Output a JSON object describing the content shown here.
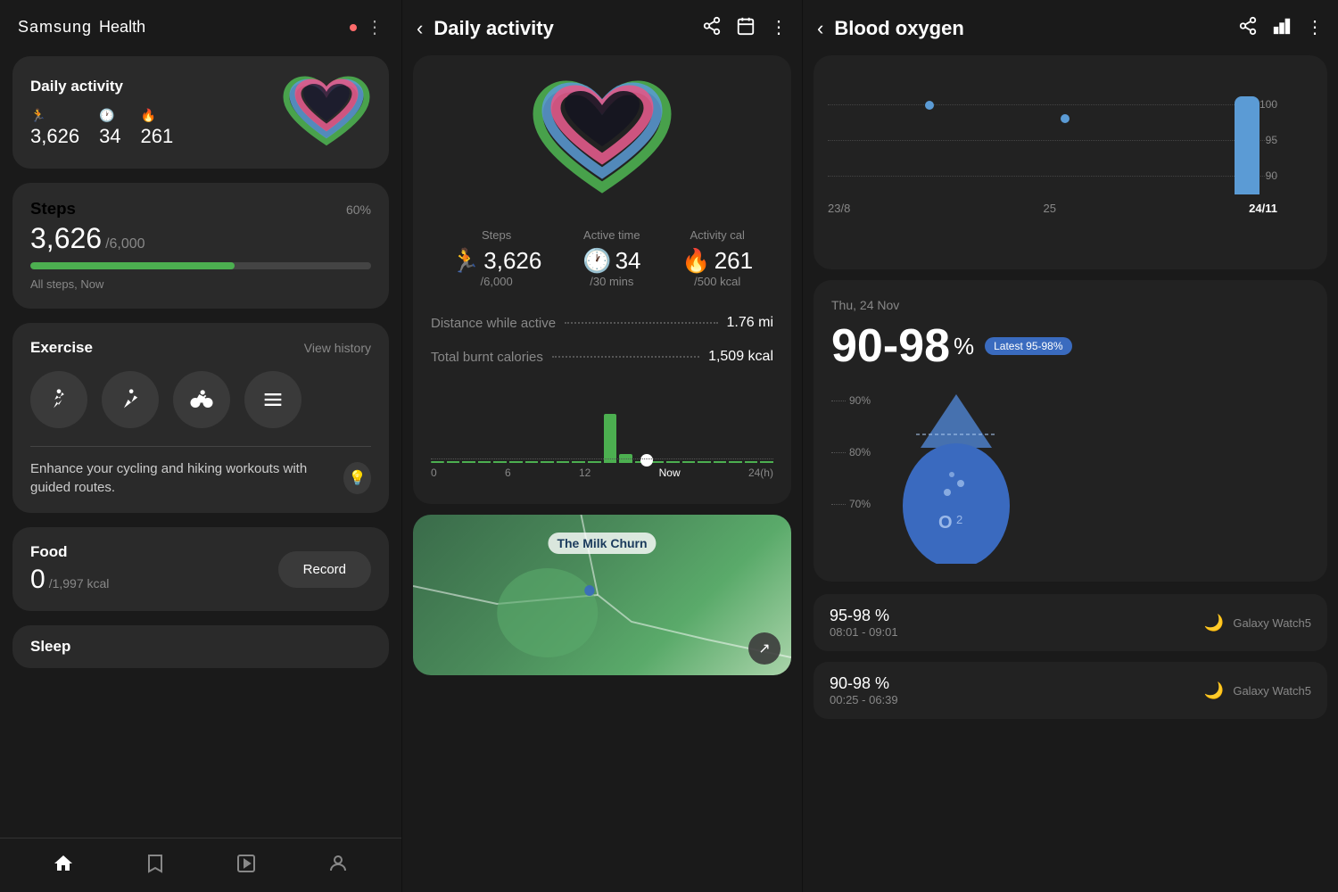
{
  "app": {
    "name": "Samsung",
    "sub": "Health"
  },
  "left": {
    "header": {
      "brand": "Samsung",
      "health": "Health",
      "more_label": "⋮"
    },
    "daily_activity": {
      "title": "Daily activity",
      "steps_icon": "🏃",
      "steps_value": "3,626",
      "active_icon": "🕐",
      "active_value": "34",
      "cal_icon": "🔥",
      "cal_value": "261"
    },
    "steps": {
      "title": "Steps",
      "value": "3,626",
      "goal": "/6,000",
      "percent": "60%",
      "progress": 60,
      "sub": "All steps, Now"
    },
    "exercise": {
      "title": "Exercise",
      "view_history": "View history",
      "tip": "Enhance your cycling and hiking workouts with guided routes."
    },
    "food": {
      "title": "Food",
      "value": "0",
      "goal": "/1,997 kcal",
      "record_btn": "Record"
    },
    "sleep": {
      "title": "Sleep"
    },
    "nav": {
      "home": "🏠",
      "bookmark": "🔖",
      "play": "▶",
      "person": "👤"
    }
  },
  "center": {
    "header": {
      "back": "‹",
      "title": "Daily activity",
      "share": "share-icon",
      "calendar": "calendar-icon",
      "more": "more-icon"
    },
    "stats": {
      "steps_label": "Steps",
      "steps_icon": "🏃",
      "steps_value": "3,626",
      "steps_goal": "/6,000",
      "active_label": "Active time",
      "active_icon": "🕐",
      "active_value": "34",
      "active_goal": "/30 mins",
      "cal_label": "Activity cal",
      "cal_icon": "🔥",
      "cal_value": "261",
      "cal_goal": "/500 kcal"
    },
    "metrics": {
      "distance_label": "Distance while active",
      "distance_value": "1.76 mi",
      "calories_label": "Total burnt calories",
      "calories_value": "1,509 kcal"
    },
    "chart": {
      "labels": [
        "0",
        "6",
        "12",
        "Now",
        "24(h)"
      ]
    },
    "map": {
      "place": "The Milk Churn"
    }
  },
  "right": {
    "header": {
      "back": "‹",
      "title": "Blood oxygen",
      "share": "share-icon",
      "bars": "bars-icon",
      "more": "more-icon"
    },
    "chart": {
      "labels": [
        "23/8",
        "25",
        "24/11"
      ],
      "y_labels": [
        "100",
        "95",
        "90"
      ],
      "selected": "24/11"
    },
    "reading": {
      "date": "Thu, 24 Nov",
      "value": "90-98",
      "unit": "%",
      "latest_badge": "Latest 95-98%",
      "scale": {
        "90": "90%",
        "80": "80%",
        "70": "70%"
      },
      "o2_label": "O₂"
    },
    "history": [
      {
        "value": "95-98 %",
        "time": "08:01 - 09:01",
        "device": "Galaxy Watch5",
        "icon": "🌙"
      },
      {
        "value": "90-98 %",
        "time": "00:25 - 06:39",
        "device": "Galaxy Watch5",
        "icon": "🌙"
      }
    ]
  }
}
